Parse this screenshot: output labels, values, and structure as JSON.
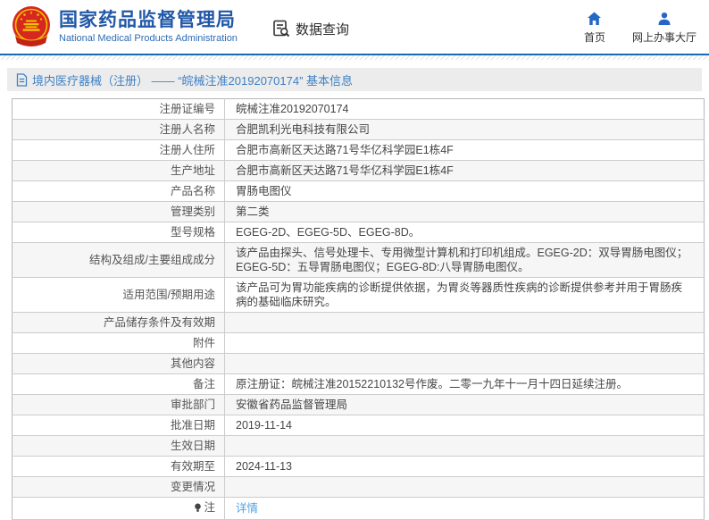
{
  "header": {
    "title": "国家药品监督管理局",
    "subtitle": "National Medical Products Administration",
    "section_label": "数据查询",
    "nav": [
      {
        "label": "首页",
        "icon": "home-icon"
      },
      {
        "label": "网上办事大厅",
        "icon": "user-icon"
      }
    ]
  },
  "breadcrumb": {
    "text": "境内医疗器械（注册） ——  “皖械注准20192070174”  基本信息"
  },
  "table": {
    "rows": [
      {
        "label": "注册证编号",
        "value": "皖械注准20192070174"
      },
      {
        "label": "注册人名称",
        "value": "合肥凯利光电科技有限公司"
      },
      {
        "label": "注册人住所",
        "value": "合肥市高新区天达路71号华亿科学园E1栋4F"
      },
      {
        "label": "生产地址",
        "value": "合肥市高新区天达路71号华亿科学园E1栋4F"
      },
      {
        "label": "产品名称",
        "value": "胃肠电图仪"
      },
      {
        "label": "管理类别",
        "value": "第二类"
      },
      {
        "label": "型号规格",
        "value": "EGEG-2D、EGEG-5D、EGEG-8D。"
      },
      {
        "label": "结构及组成/主要组成成分",
        "value": "该产品由探头、信号处理卡、专用微型计算机和打印机组成。EGEG-2D：双导胃肠电图仪；EGEG-5D：五导胃肠电图仪；EGEG-8D:八导胃肠电图仪。"
      },
      {
        "label": "适用范围/预期用途",
        "value": "该产品可为胃功能疾病的诊断提供依据，为胃炎等器质性疾病的诊断提供参考并用于胃肠疾病的基础临床研究。"
      },
      {
        "label": "产品储存条件及有效期",
        "value": ""
      },
      {
        "label": "附件",
        "value": ""
      },
      {
        "label": "其他内容",
        "value": ""
      },
      {
        "label": "备注",
        "value": "原注册证：皖械注准20152210132号作废。二零一九年十一月十四日延续注册。"
      },
      {
        "label": "审批部门",
        "value": "安徽省药品监督管理局"
      },
      {
        "label": "批准日期",
        "value": "2019-11-14"
      },
      {
        "label": "生效日期",
        "value": ""
      },
      {
        "label": "有效期至",
        "value": "2024-11-13"
      },
      {
        "label": "变更情况",
        "value": ""
      },
      {
        "label": "注",
        "value": "详情",
        "link": true,
        "icon": "note-icon"
      }
    ]
  },
  "colors": {
    "header_blue": "#2158a8",
    "icon_blue": "#2467c5",
    "divider_blue": "#1a67b2",
    "link_blue": "#4da3e8",
    "breadcrumb_bg": "#ececec",
    "row_alt_bg": "#f6f6f6",
    "table_border": "#c6c6c6",
    "emblem_red": "#d6281e",
    "emblem_gold": "#f2c200"
  }
}
